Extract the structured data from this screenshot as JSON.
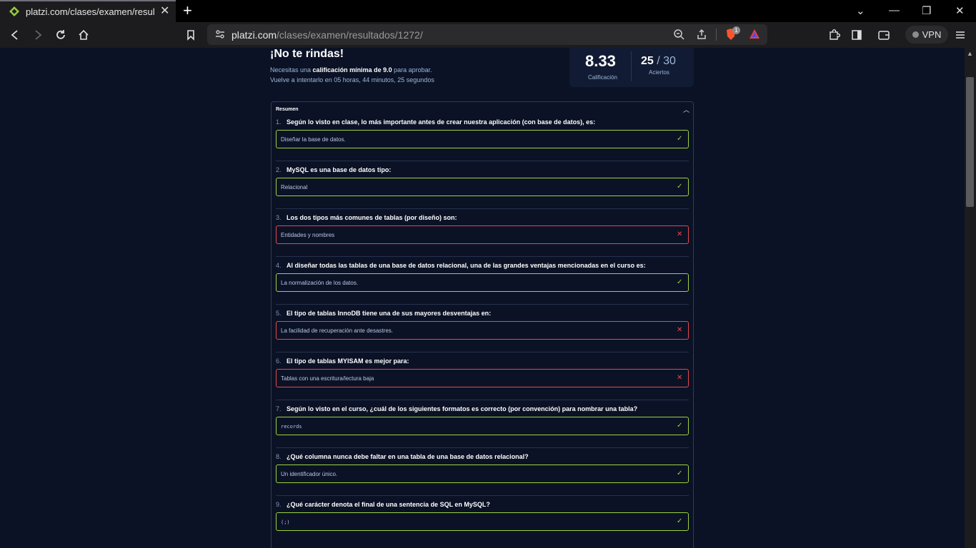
{
  "browser": {
    "tab_title": "platzi.com/clases/examen/resultados/1272/",
    "url_host": "platzi.com",
    "url_path": "/clases/examen/resultados/1272/",
    "vpn_label": "VPN",
    "brave_badge": "1"
  },
  "result": {
    "heading": "¡No te rindas!",
    "need_prefix": "Necesitas una ",
    "need_bold": "calificación mínima de 9.0",
    "need_suffix": " para aprobar.",
    "retry": "Vuelve a intentarlo en 05 horas, 44 minutos, 25 segundos",
    "score": "8.33",
    "score_label": "Calificación",
    "hits": "25",
    "hits_total": "/ 30",
    "hits_label": "Aciertos"
  },
  "summary": {
    "title": "Resumen",
    "questions": [
      {
        "num": "1.",
        "text": "Según lo visto en clase, lo más importante antes de crear nuestra aplicación (con base de datos), es:",
        "answer": "Diseñar la base de datos.",
        "status": "ok",
        "mono": false
      },
      {
        "num": "2.",
        "text": "MySQL es una base de datos tipo:",
        "answer": "Relacional",
        "status": "ok",
        "mono": false
      },
      {
        "num": "3.",
        "text": "Los dos tipos más comunes de tablas (por diseño) son:",
        "answer": "Entidades y nombres",
        "status": "bad",
        "mono": false
      },
      {
        "num": "4.",
        "text": "Al diseñar todas las tablas de una base de datos relacional, una de las grandes ventajas mencionadas en el curso es:",
        "answer": "La normalización de los datos.",
        "status": "ok",
        "mono": false
      },
      {
        "num": "5.",
        "text": "El tipo de tablas InnoDB tiene una de sus mayores desventajas en:",
        "answer": "La facilidad de recuperación ante desastres.",
        "status": "bad",
        "mono": false
      },
      {
        "num": "6.",
        "text": "El tipo de tablas MYISAM es mejor para:",
        "answer": "Tablas con una escritura/lectura baja",
        "status": "bad",
        "mono": false
      },
      {
        "num": "7.",
        "text": "Según lo visto en el curso, ¿cuál de los siguientes formatos es correcto (por convención) para nombrar una tabla?",
        "answer": "records",
        "status": "ok",
        "mono": true
      },
      {
        "num": "8.",
        "text": "¿Qué columna nunca debe faltar en una tabla de una base de datos relacional?",
        "answer": "Un identificador único.",
        "status": "ok",
        "mono": false
      },
      {
        "num": "9.",
        "text": "¿Qué carácter denota el final de una sentencia de SQL en MySQL?",
        "answer": "(;)",
        "status": "ok",
        "mono": true
      }
    ]
  },
  "colors": {
    "background": "#0b1226",
    "correct": "#9bd23b",
    "incorrect": "#e5484d"
  },
  "icons": {
    "correct": "check-icon",
    "incorrect": "x-icon"
  }
}
